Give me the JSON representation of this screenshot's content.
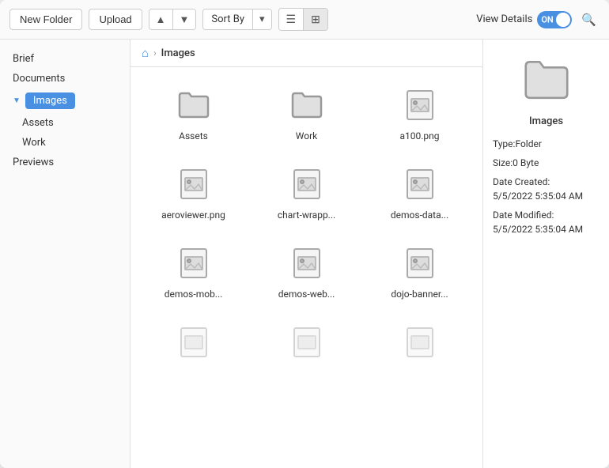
{
  "toolbar": {
    "new_folder_label": "New Folder",
    "upload_label": "Upload",
    "sort_by_label": "Sort By",
    "view_details_label": "View Details",
    "toggle_text": "ON",
    "up_icon": "▲",
    "down_icon": "▼",
    "dropdown_icon": "▾",
    "list_view_icon": "☰",
    "grid_view_icon": "⊞",
    "search_icon": "🔍"
  },
  "sidebar": {
    "items": [
      {
        "label": "Brief",
        "active": false,
        "sub": false
      },
      {
        "label": "Documents",
        "active": false,
        "sub": false
      },
      {
        "label": "Images",
        "active": true,
        "sub": false
      },
      {
        "label": "Assets",
        "active": false,
        "sub": true
      },
      {
        "label": "Work",
        "active": false,
        "sub": true
      },
      {
        "label": "Previews",
        "active": false,
        "sub": false
      }
    ]
  },
  "breadcrumb": {
    "home_icon": "⌂",
    "separator": "›",
    "current": "Images"
  },
  "files": [
    {
      "name": "Assets",
      "type": "folder"
    },
    {
      "name": "Work",
      "type": "folder"
    },
    {
      "name": "a100.png",
      "type": "image"
    },
    {
      "name": "aeroviewer.png",
      "type": "image"
    },
    {
      "name": "chart-wrapp...",
      "type": "image"
    },
    {
      "name": "demos-data...",
      "type": "image"
    },
    {
      "name": "demos-mob...",
      "type": "image"
    },
    {
      "name": "demos-web...",
      "type": "image"
    },
    {
      "name": "dojo-banner...",
      "type": "image"
    },
    {
      "name": "",
      "type": "image"
    },
    {
      "name": "",
      "type": "image"
    },
    {
      "name": "",
      "type": "image"
    }
  ],
  "details": {
    "name": "Images",
    "type_label": "Type:",
    "type_value": "Folder",
    "size_label": "Size:",
    "size_value": "0 Byte",
    "created_label": "Date Created:",
    "created_value": "5/5/2022 5:35:04 AM",
    "modified_label": "Date Modified:",
    "modified_value": "5/5/2022 5:35:04 AM"
  }
}
